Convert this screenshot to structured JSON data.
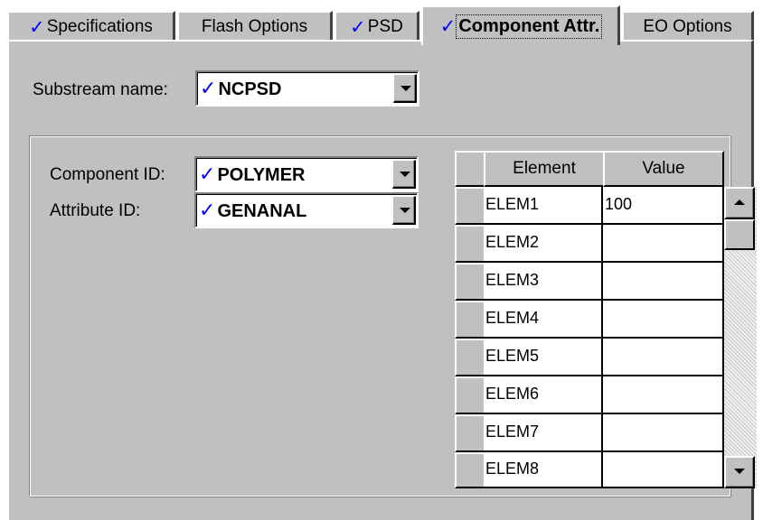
{
  "tabs": [
    {
      "label": "Specifications",
      "checked": true,
      "active": false
    },
    {
      "label": "Flash Options",
      "checked": false,
      "active": false
    },
    {
      "label": "PSD",
      "checked": true,
      "active": false
    },
    {
      "label": "Component Attr.",
      "checked": true,
      "active": true
    },
    {
      "label": "EO Options",
      "checked": false,
      "active": false
    }
  ],
  "check_glyph": "✓",
  "substream": {
    "label": "Substream name:",
    "value": "NCPSD"
  },
  "component": {
    "label": "Component ID:",
    "value": "POLYMER"
  },
  "attribute": {
    "label": "Attribute ID:",
    "value": "GENANAL"
  },
  "grid": {
    "columns": [
      "Element",
      "Value"
    ],
    "rows": [
      {
        "element": "ELEM1",
        "value": "100"
      },
      {
        "element": "ELEM2",
        "value": ""
      },
      {
        "element": "ELEM3",
        "value": ""
      },
      {
        "element": "ELEM4",
        "value": ""
      },
      {
        "element": "ELEM5",
        "value": ""
      },
      {
        "element": "ELEM6",
        "value": ""
      },
      {
        "element": "ELEM7",
        "value": ""
      },
      {
        "element": "ELEM8",
        "value": ""
      }
    ]
  },
  "colors": {
    "check": "#0000ff",
    "face": "#c0c0c0"
  },
  "icons": {
    "combo_button": "chevron-down-icon",
    "scroll_up": "arrow-up-icon",
    "scroll_down": "arrow-down-icon"
  }
}
